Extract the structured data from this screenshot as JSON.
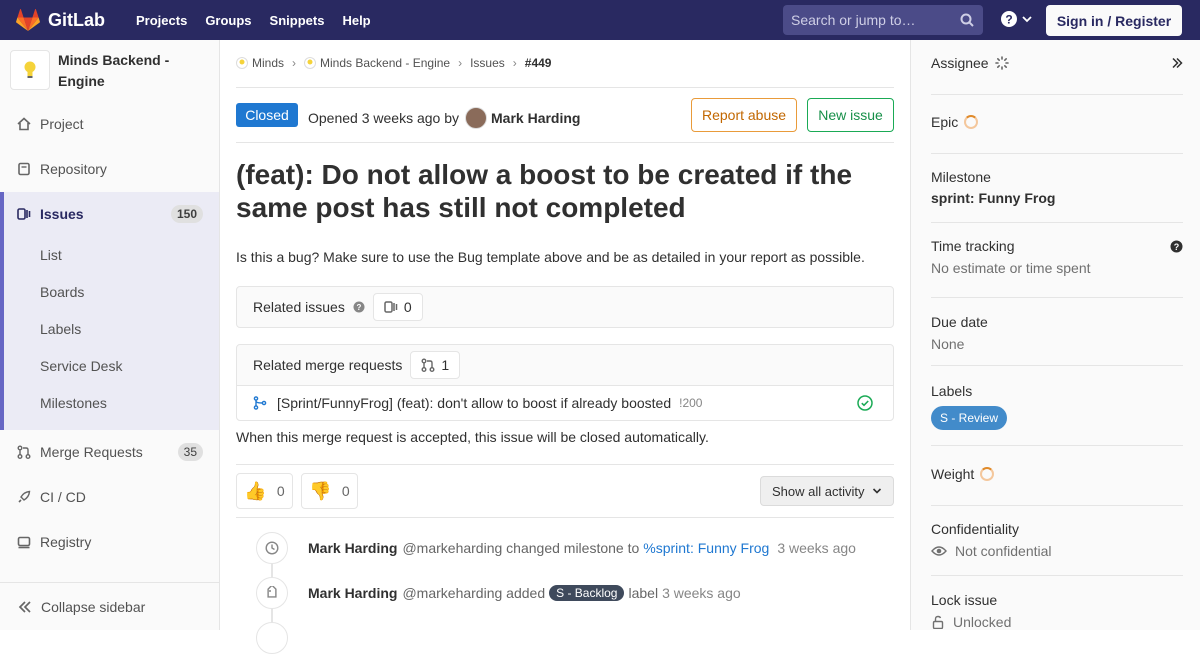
{
  "topnav": {
    "brand": "GitLab",
    "links": [
      "Projects",
      "Groups",
      "Snippets",
      "Help"
    ],
    "search_placeholder": "Search or jump to…",
    "signin": "Sign in / Register"
  },
  "sidebar": {
    "project_name": "Minds Backend - Engine",
    "items": [
      {
        "label": "Project",
        "icon": "home-icon"
      },
      {
        "label": "Repository",
        "icon": "doc-icon"
      },
      {
        "label": "Issues",
        "icon": "issues-icon",
        "count": "150"
      },
      {
        "label": "Merge Requests",
        "icon": "merge-request-icon",
        "count": "35"
      },
      {
        "label": "CI / CD",
        "icon": "rocket-icon"
      },
      {
        "label": "Registry",
        "icon": "container-icon"
      }
    ],
    "sub_items": [
      "List",
      "Boards",
      "Labels",
      "Service Desk",
      "Milestones"
    ],
    "collapse": "Collapse sidebar"
  },
  "breadcrumb": [
    "Minds",
    "Minds Backend - Engine",
    "Issues",
    "#449"
  ],
  "issue": {
    "status": "Closed",
    "opened": "Opened",
    "time_ago": "3 weeks ago",
    "by": "by",
    "author": "Mark Harding",
    "report_abuse": "Report abuse",
    "new_issue": "New issue",
    "title": "(feat): Do not allow a boost to be created if the same post has still not completed",
    "description": "Is this a bug? Make sure to use the Bug template above and be as detailed in your report as possible."
  },
  "related_issues": {
    "label": "Related issues",
    "count": "0"
  },
  "related_mrs": {
    "label": "Related merge requests",
    "count": "1",
    "mr_title": "[Sprint/FunnyFrog] (feat): don't allow to boost if already boosted",
    "mr_ref": "!200"
  },
  "auto_close": "When this merge request is accepted, this issue will be closed automatically.",
  "awards": {
    "thumbsup": "0",
    "thumbsdown": "0"
  },
  "activity_filter": "Show all activity",
  "timeline": [
    {
      "author": "Mark Harding",
      "handle": "@markeharding",
      "action": "changed milestone to",
      "link": "%sprint: Funny Frog",
      "time": "3 weeks ago"
    },
    {
      "author": "Mark Harding",
      "handle": "@markeharding",
      "action": "added",
      "label": "S - Backlog",
      "suffix": "label",
      "time": "3 weeks ago"
    }
  ],
  "right": {
    "assignee": "Assignee",
    "epic": "Epic",
    "milestone_title": "Milestone",
    "milestone_value": "sprint: Funny Frog",
    "time_tracking": "Time tracking",
    "time_value": "No estimate or time spent",
    "due_date": "Due date",
    "due_value": "None",
    "labels": "Labels",
    "label_value": "S - Review",
    "weight": "Weight",
    "confidentiality": "Confidentiality",
    "confidentiality_value": "Not confidential",
    "lock": "Lock issue",
    "lock_value": "Unlocked"
  },
  "colors": {
    "nav": "#292961",
    "closed": "#1f78d1",
    "review_label": "#428bca",
    "backlog_label": "#3f4a5c"
  }
}
